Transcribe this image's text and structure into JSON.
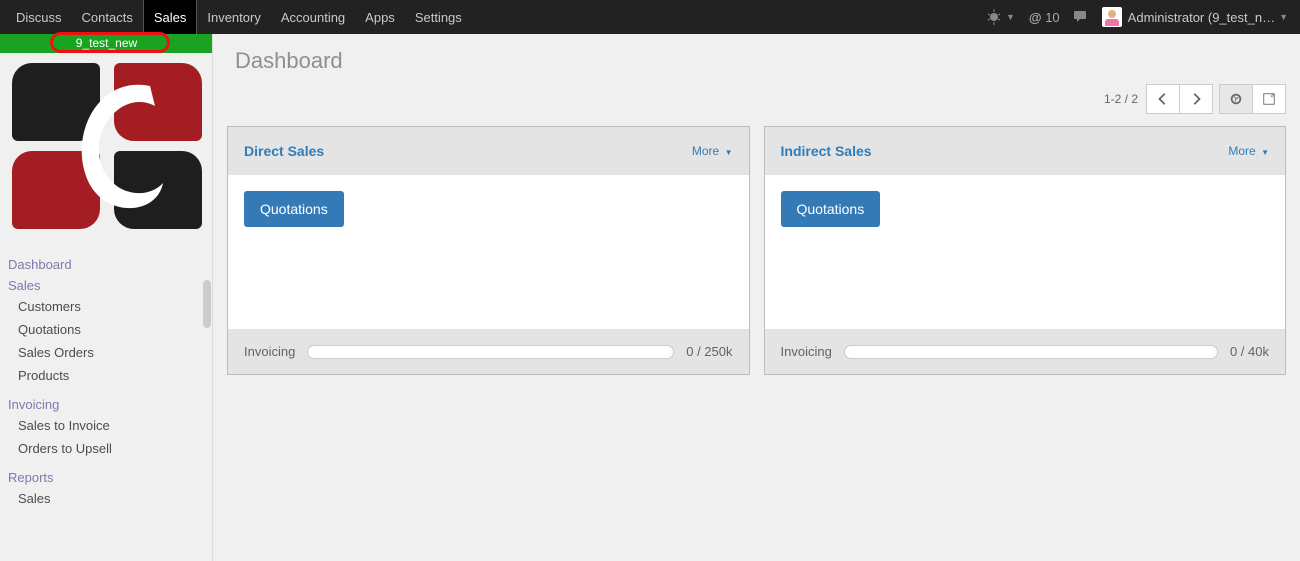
{
  "navbar": {
    "items": [
      "Discuss",
      "Contacts",
      "Sales",
      "Inventory",
      "Accounting",
      "Apps",
      "Settings"
    ],
    "active_index": 2,
    "msg_count": "10",
    "user_label": "Administrator (9_test_n…"
  },
  "db_bar": {
    "name": "9_test_new"
  },
  "page": {
    "title": "Dashboard",
    "pager": "1-2 / 2"
  },
  "sidebar": {
    "headers": [
      "Dashboard",
      "Sales",
      "Invoicing",
      "Reports"
    ],
    "sales_items": [
      "Customers",
      "Quotations",
      "Sales Orders",
      "Products"
    ],
    "invoicing_items": [
      "Sales to Invoice",
      "Orders to Upsell"
    ],
    "reports_items": [
      "Sales"
    ]
  },
  "cards": [
    {
      "title": "Direct Sales",
      "more": "More",
      "button": "Quotations",
      "footer_label": "Invoicing",
      "footer_value": "0 / 250k"
    },
    {
      "title": "Indirect Sales",
      "more": "More",
      "button": "Quotations",
      "footer_label": "Invoicing",
      "footer_value": "0 / 40k"
    }
  ]
}
